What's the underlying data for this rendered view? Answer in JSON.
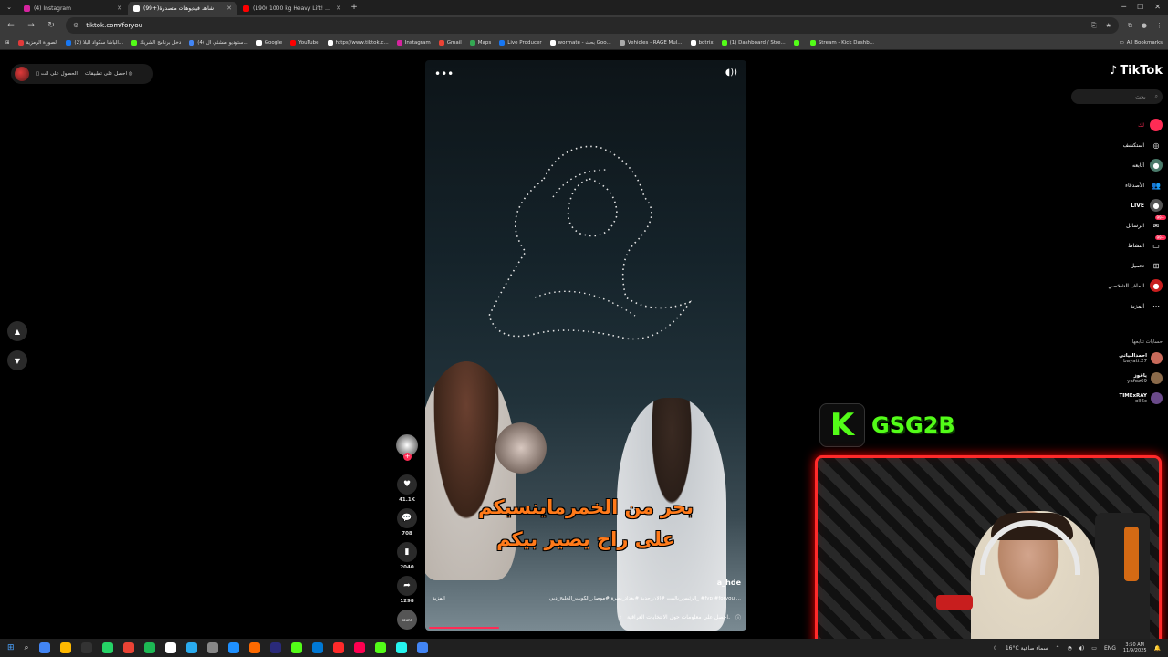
{
  "browser": {
    "tabs": [
      {
        "title": "(4) Instagram",
        "color": "#d6249f",
        "active": false
      },
      {
        "title": "(99+)شاهد فيديوهات متصدرة",
        "color": "#ffffff",
        "active": true
      },
      {
        "title": "(190) 1000 kg Heavy Lift! U.S.",
        "color": "#ff0000",
        "active": false
      }
    ],
    "new_tab": "+",
    "window_controls": [
      "─",
      "☐",
      "✕"
    ],
    "url": "tiktok.com/foryou",
    "bookmarks": [
      {
        "label": "الصورة الرمزية",
        "color": "#e03a3a"
      },
      {
        "label": "(2) الباشا سكواد البلا...",
        "color": "#1877f2"
      },
      {
        "label": "دخل برنامج الشريك",
        "color": "#53fc18"
      },
      {
        "label": "(4) ستوديو منشئي ال...",
        "color": "#4285f4"
      },
      {
        "label": "Google",
        "color": "#ffffff"
      },
      {
        "label": "YouTube",
        "color": "#ff0000"
      },
      {
        "label": "https//www.tiktok.c...",
        "color": "#ffffff"
      },
      {
        "label": "Instagram",
        "color": "#d6249f"
      },
      {
        "label": "Gmail",
        "color": "#ea4335"
      },
      {
        "label": "Maps",
        "color": "#34a853"
      },
      {
        "label": "Live Producer",
        "color": "#1877f2"
      },
      {
        "label": "wormate - بحث Goo...",
        "color": "#ffffff"
      },
      {
        "label": "Vehicles - RAGE Mul...",
        "color": "#aaaaaa"
      },
      {
        "label": "botrix",
        "color": "#ffffff"
      },
      {
        "label": "(1) Dashboard / Stre...",
        "color": "#53fc18"
      },
      {
        "label": "",
        "color": "#53fc18"
      },
      {
        "label": "Stream - Kick Dashb...",
        "color": "#53fc18"
      }
    ],
    "all_bookmarks": "All Bookmarks"
  },
  "tiktok": {
    "get_app": "احصل على تطبيقات",
    "get_pc": "الحصول على الت",
    "logo": "TikTok",
    "search_placeholder": "بحث",
    "nav": [
      {
        "label": "لك",
        "icon": "home-icon",
        "color": "#fe2c55",
        "glyph": "⌂",
        "badge": ""
      },
      {
        "label": "استكشف",
        "icon": "compass-icon",
        "color": "transparent",
        "glyph": "◎",
        "badge": ""
      },
      {
        "label": "أتابعه",
        "icon": "following-icon",
        "color": "#4a7a6a",
        "glyph": "●",
        "badge": ""
      },
      {
        "label": "الأصدقاء",
        "icon": "friends-icon",
        "color": "transparent",
        "glyph": "👥",
        "badge": ""
      },
      {
        "label": "LIVE",
        "icon": "live-icon",
        "color": "#555555",
        "glyph": "●",
        "badge": ""
      },
      {
        "label": "الرسائل",
        "icon": "messages-icon",
        "color": "transparent",
        "glyph": "✉",
        "badge": "99+"
      },
      {
        "label": "النشاط",
        "icon": "activity-icon",
        "color": "transparent",
        "glyph": "▭",
        "badge": "99+"
      },
      {
        "label": "تحميل",
        "icon": "upload-icon",
        "color": "transparent",
        "glyph": "⊞",
        "badge": ""
      },
      {
        "label": "الملف الشخصي",
        "icon": "profile-icon",
        "color": "#c81e1e",
        "glyph": "●",
        "badge": ""
      },
      {
        "label": "المزيد",
        "icon": "more-icon",
        "color": "transparent",
        "glyph": "⋯",
        "badge": ""
      }
    ],
    "following_header": "حسابات تتابعها",
    "following": [
      {
        "name": "احمدالبياتي",
        "user": "bayati.27",
        "color": "#c86a5a"
      },
      {
        "name": "ياقوز",
        "user": "yafoz69",
        "color": "#8a6a4a"
      },
      {
        "name": "TIMExRAY",
        "user": "oll6c",
        "color": "#6a4a8a"
      }
    ],
    "video": {
      "subtitle_line1": "بحر من الخمرماينسيكم",
      "subtitle_line2": "على راح يصير بيكم",
      "author": "a_hde",
      "caption": "الرئيس_باليبت #الان_جديد #بغداد_بصرة #موصل_الكويت_الخليج_دبي_ #fyp #foryou ...",
      "more": "المزيد",
      "info": "احصل على معلومات حول الانتخابات العراقية.",
      "progress": 0.22
    },
    "actions": {
      "likes": "41.1K",
      "comments": "708",
      "saves": "2040",
      "shares": "1298",
      "sound_label": "sound"
    }
  },
  "overlay": {
    "kick_letter": "K",
    "streamer_name": "GSG2B"
  },
  "taskbar": {
    "weather": "16°C  سماء صافية",
    "lang": "ENG",
    "time": "3:50 AM",
    "date": "11/9/2025",
    "icon_colors": [
      "#4285f4",
      "#ffb900",
      "#333333",
      "#25d366",
      "#ea4335",
      "#1db954",
      "#ffffff",
      "#2aabee",
      "#888888",
      "#1e90ff",
      "#ff6a00",
      "#2a2a7a",
      "#53fc18",
      "#0078d4",
      "#ff2a2a",
      "#ff0050",
      "#53fc18",
      "#25f4ee",
      "#4285f4"
    ]
  }
}
